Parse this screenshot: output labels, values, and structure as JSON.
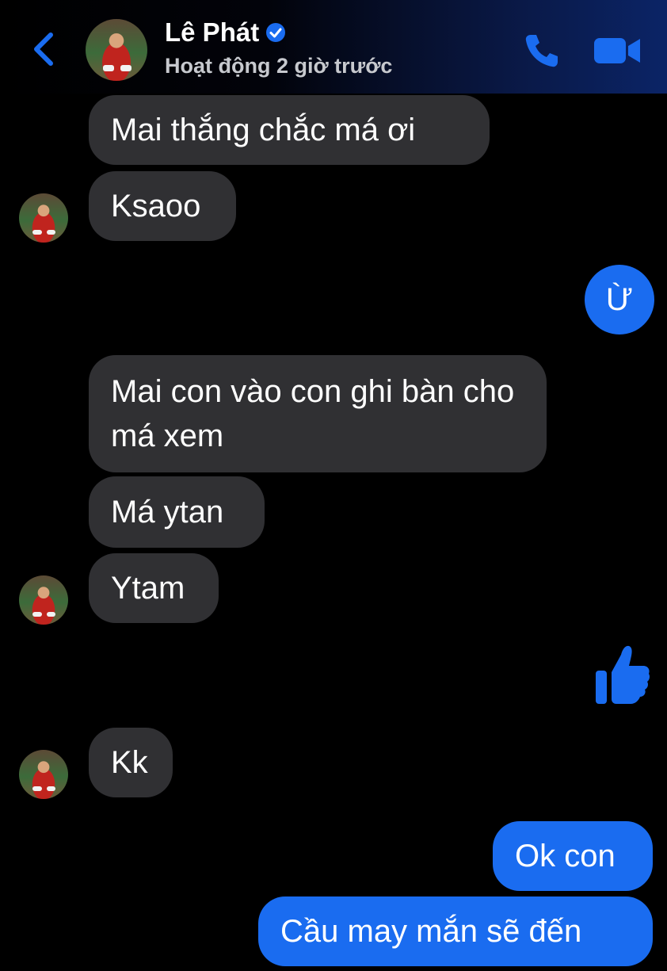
{
  "header": {
    "contact_name": "Lê Phát",
    "status": "Hoạt động 2 giờ trước",
    "icons": [
      "back-chevron-icon",
      "verified-badge-icon",
      "phone-call-icon",
      "video-call-icon"
    ]
  },
  "messages": [
    {
      "from": "contact",
      "text": "Mai thắng chắc má ơi"
    },
    {
      "from": "contact",
      "text": "Ksaoo"
    },
    {
      "from": "me",
      "text": "Ừ"
    },
    {
      "from": "contact",
      "text": "Mai con vào con ghi bàn cho má xem"
    },
    {
      "from": "contact",
      "text": "Má ytan"
    },
    {
      "from": "contact",
      "text": "Ytam"
    },
    {
      "from": "me",
      "type": "like",
      "icon": "thumbs-up-icon"
    },
    {
      "from": "contact",
      "text": "Kk"
    },
    {
      "from": "me",
      "text": "Ok con"
    },
    {
      "from": "me",
      "text": "Cầu may mắn sẽ đến"
    }
  ],
  "colors": {
    "accent": "#1a6cf0",
    "incoming_bubble": "#303033",
    "background": "#000000"
  }
}
